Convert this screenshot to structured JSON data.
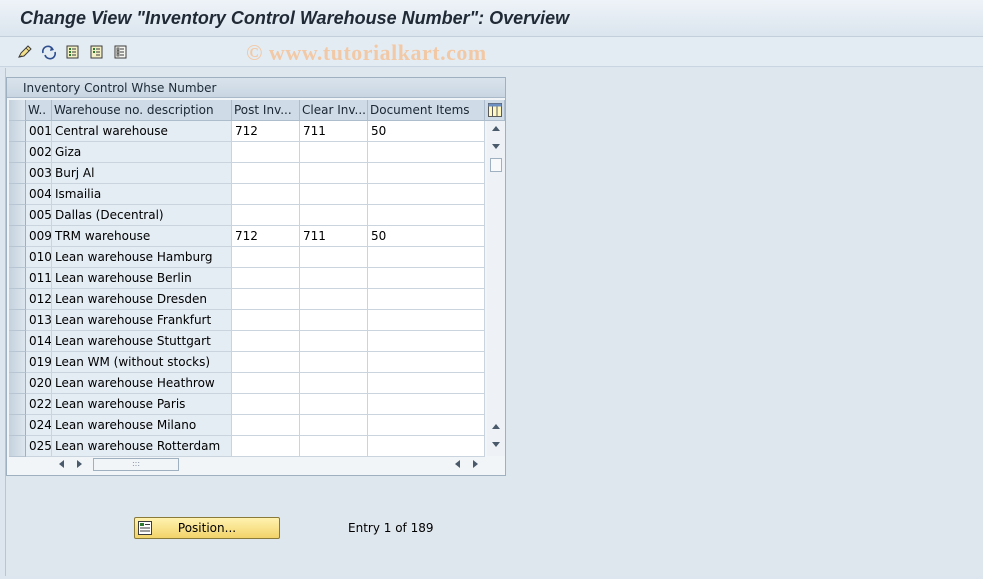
{
  "window": {
    "title": "Change View \"Inventory Control Warehouse Number\": Overview",
    "watermark": "© www.tutorialkart.com"
  },
  "toolbar": {
    "buttons": [
      {
        "icon": "display-change-icon"
      },
      {
        "icon": "other-view-icon"
      },
      {
        "icon": "select-all-icon"
      },
      {
        "icon": "select-block-icon"
      },
      {
        "icon": "deselect-all-icon"
      }
    ]
  },
  "table": {
    "title": "Inventory Control Whse Number",
    "columns": [
      "W..",
      "Warehouse no. description",
      "Post Inv...",
      "Clear Inv...",
      "Document Items"
    ],
    "rows": [
      {
        "wh": "001",
        "desc": "Central warehouse",
        "post": "712",
        "clear": "711",
        "docs": "50"
      },
      {
        "wh": "002",
        "desc": "Giza",
        "post": "",
        "clear": "",
        "docs": ""
      },
      {
        "wh": "003",
        "desc": "Burj Al",
        "post": "",
        "clear": "",
        "docs": ""
      },
      {
        "wh": "004",
        "desc": "Ismailia",
        "post": "",
        "clear": "",
        "docs": ""
      },
      {
        "wh": "005",
        "desc": "Dallas (Decentral)",
        "post": "",
        "clear": "",
        "docs": ""
      },
      {
        "wh": "009",
        "desc": "TRM warehouse",
        "post": "712",
        "clear": "711",
        "docs": "50"
      },
      {
        "wh": "010",
        "desc": "Lean warehouse Hamburg",
        "post": "",
        "clear": "",
        "docs": ""
      },
      {
        "wh": "011",
        "desc": "Lean warehouse Berlin",
        "post": "",
        "clear": "",
        "docs": ""
      },
      {
        "wh": "012",
        "desc": "Lean warehouse Dresden",
        "post": "",
        "clear": "",
        "docs": ""
      },
      {
        "wh": "013",
        "desc": "Lean warehouse Frankfurt",
        "post": "",
        "clear": "",
        "docs": ""
      },
      {
        "wh": "014",
        "desc": "Lean warehouse Stuttgart",
        "post": "",
        "clear": "",
        "docs": ""
      },
      {
        "wh": "019",
        "desc": "Lean WM (without stocks)",
        "post": "",
        "clear": "",
        "docs": ""
      },
      {
        "wh": "020",
        "desc": "Lean warehouse Heathrow",
        "post": "",
        "clear": "",
        "docs": ""
      },
      {
        "wh": "022",
        "desc": "Lean warehouse Paris",
        "post": "",
        "clear": "",
        "docs": ""
      },
      {
        "wh": "024",
        "desc": "Lean warehouse Milano",
        "post": "",
        "clear": "",
        "docs": ""
      },
      {
        "wh": "025",
        "desc": "Lean warehouse Rotterdam",
        "post": "",
        "clear": "",
        "docs": ""
      }
    ]
  },
  "footer": {
    "position_button": "Position...",
    "entry_text": "Entry 1 of 189"
  },
  "colors": {
    "accent_button": "#f2d36a",
    "title_text": "#1f2a36",
    "watermark": "#f2c9a6"
  }
}
